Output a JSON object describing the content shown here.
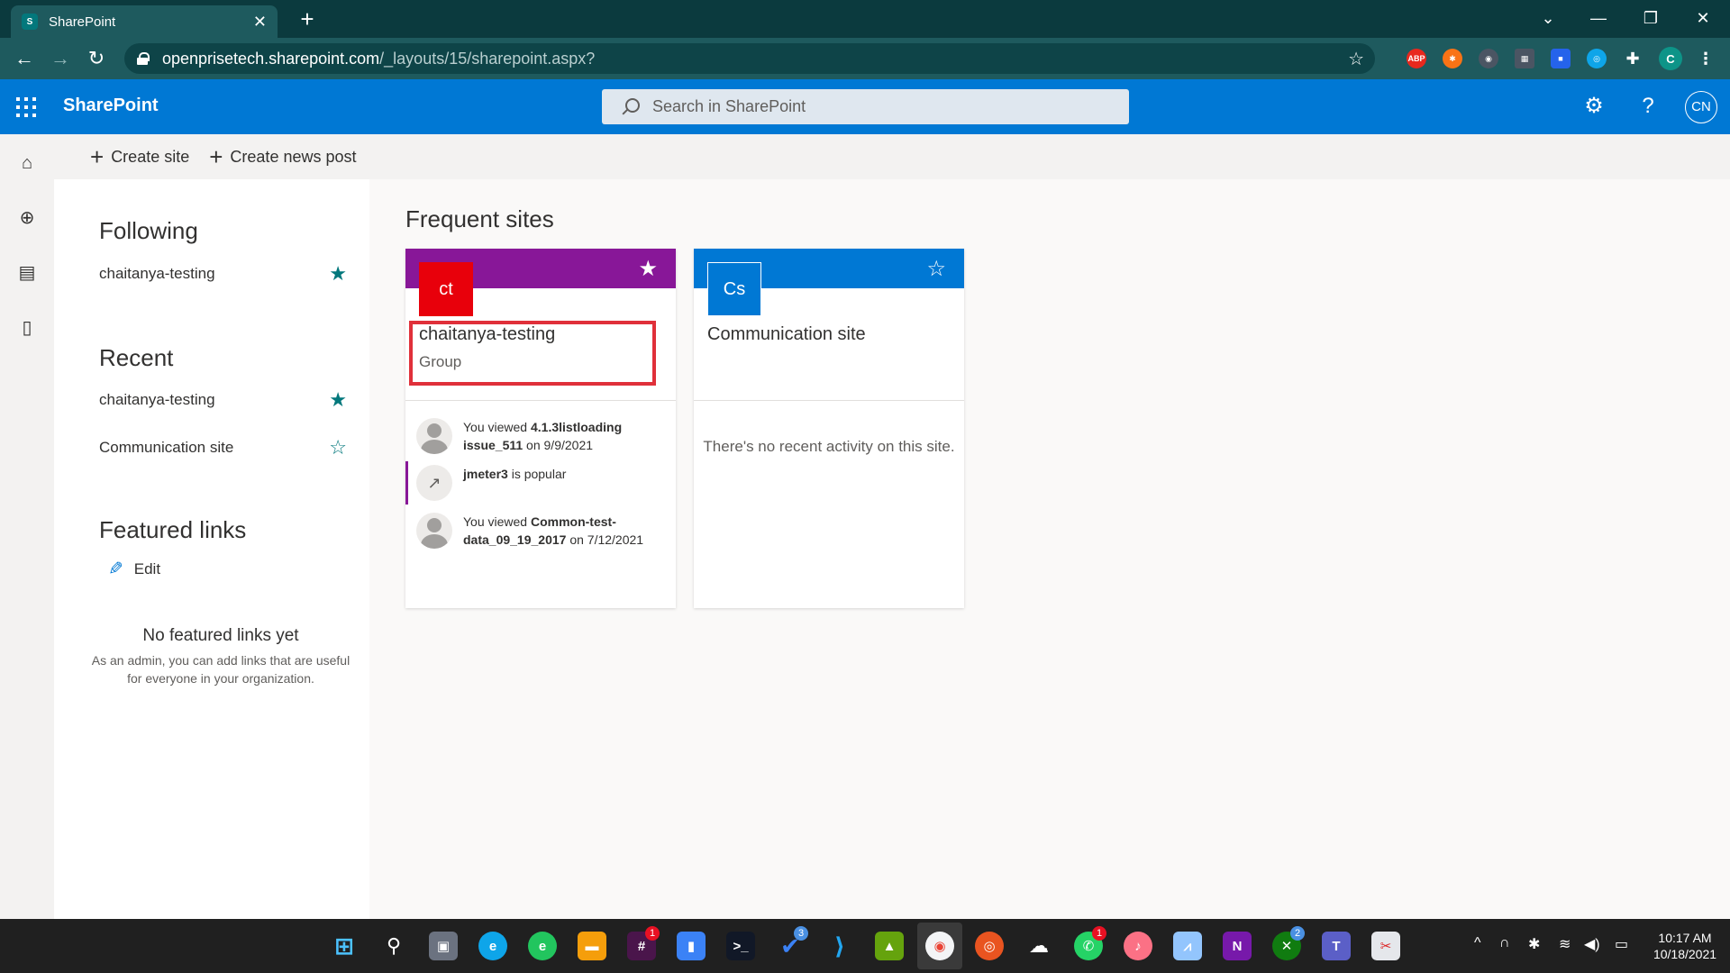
{
  "browser": {
    "tab_title": "SharePoint",
    "favicon_text": "S",
    "url_host": "openprisetech.sharepoint.com",
    "url_path": "/_layouts/15/sharepoint.aspx?",
    "profile_initial": "C",
    "extensions": [
      {
        "name": "adblock-extension",
        "label": "ABP",
        "color": "#e8281e"
      },
      {
        "name": "orange-extension",
        "label": "✱",
        "color": "#f97316"
      },
      {
        "name": "globe-extension",
        "label": "◉",
        "color": "#1e5a5e"
      },
      {
        "name": "qr-extension",
        "label": "▦",
        "color": "#1e5a5e"
      },
      {
        "name": "meet-extension",
        "label": "■",
        "color": "#2563eb"
      },
      {
        "name": "blue-extension",
        "label": "◎",
        "color": "#0ea5e9"
      }
    ]
  },
  "suite": {
    "brand": "SharePoint",
    "search_placeholder": "Search in SharePoint",
    "avatar_initials": "CN",
    "accent": "#0078d4"
  },
  "commands": {
    "create_site": "Create site",
    "create_news_post": "Create news post"
  },
  "left_panel": {
    "following_heading": "Following",
    "following": [
      {
        "label": "chaitanya-testing",
        "starred": true
      }
    ],
    "recent_heading": "Recent",
    "recent": [
      {
        "label": "chaitanya-testing",
        "starred": true
      },
      {
        "label": "Communication site",
        "starred": false
      }
    ],
    "featured_heading": "Featured links",
    "edit_label": "Edit",
    "no_featured_title": "No featured links yet",
    "no_featured_desc": "As an admin, you can add links that are useful for everyone in your organization."
  },
  "main": {
    "title": "Frequent sites",
    "cards": [
      {
        "logo_text": "ct",
        "name": "chaitanya-testing",
        "type": "Group",
        "banner_color": "#881798",
        "logo_color": "#e8000b",
        "starred": true,
        "activities": [
          {
            "prefix": "You viewed ",
            "item": "4.1.3listloading issue_511",
            "suffix": " on 9/9/2021"
          },
          {
            "prefix": "",
            "item": "jmeter3",
            "suffix": " is popular"
          },
          {
            "prefix": "You viewed ",
            "item": "Common-test-data_09_19_2017",
            "suffix": " on 7/12/2021"
          }
        ]
      },
      {
        "logo_text": "Cs",
        "name": "Communication site",
        "type": "",
        "banner_color": "#0078d4",
        "logo_color": "#0078d4",
        "starred": false,
        "empty_message": "There's no recent activity on this site."
      }
    ]
  },
  "taskbar": {
    "time": "10:17 AM",
    "date": "10/18/2021",
    "badges": {
      "slack": "1",
      "todo": "3",
      "whatsapp": "1",
      "xbox": "2"
    }
  }
}
